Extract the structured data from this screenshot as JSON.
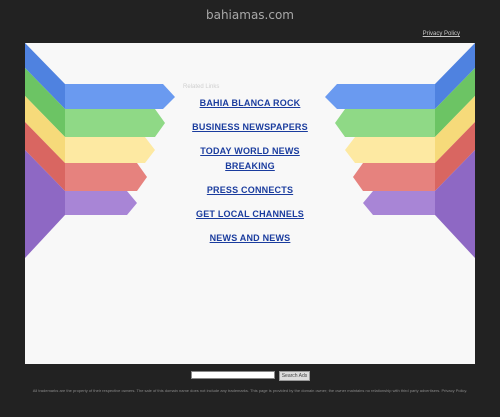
{
  "header": {
    "title": "bahiamas.com",
    "privacy_link": "Privacy Policy"
  },
  "main": {
    "related_label": "Related Links",
    "links": [
      {
        "label": "BAHIA BLANCA ROCK"
      },
      {
        "label": "BUSINESS NEWSPAPERS"
      },
      {
        "label": "TODAY WORLD NEWS"
      },
      {
        "label": "BREAKING"
      },
      {
        "label": "PRESS CONNECTS"
      },
      {
        "label": "GET LOCAL CHANNELS"
      },
      {
        "label": "NEWS AND NEWS"
      }
    ]
  },
  "search": {
    "input_value": "",
    "button_label": "Search Ads"
  },
  "footer": {
    "text": "All trademarks are the property of their respective owners. The sale of this domain name does not include any trademarks. This page is provided by the domain owner; the owner maintains no relationship with third party advertisers. Privacy Policy."
  },
  "colors": {
    "background": "#222222",
    "panel": "#f8f8f8",
    "link": "#1a3c9e",
    "stripe_blue": "#5b8fe8",
    "stripe_green": "#86d37d",
    "stripe_yellow": "#fce79b",
    "stripe_red": "#e27b77",
    "stripe_purple": "#a27fd2"
  }
}
